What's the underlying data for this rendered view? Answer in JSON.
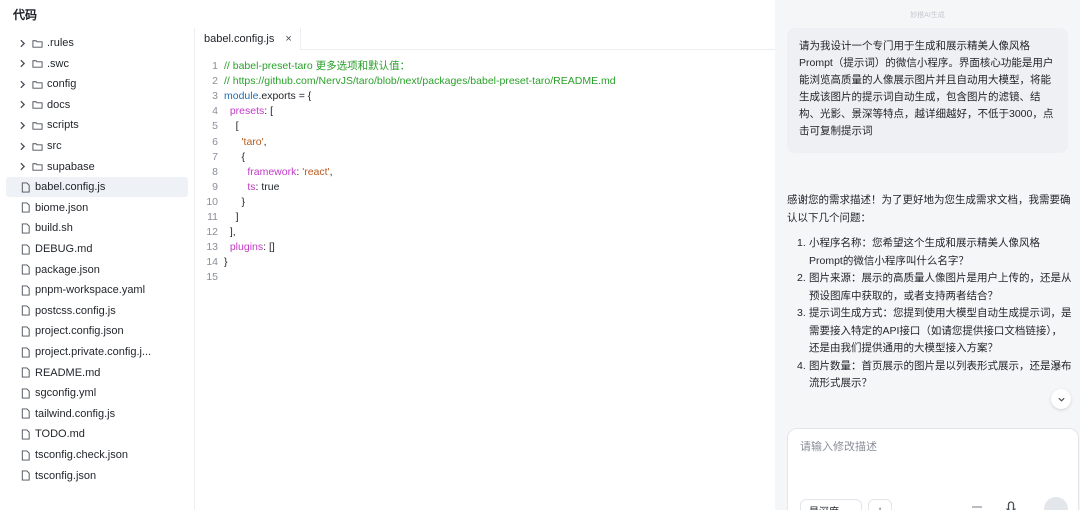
{
  "header": {
    "title": "代码"
  },
  "tree": {
    "items": [
      {
        "label": ".rules",
        "type": "folder"
      },
      {
        "label": ".swc",
        "type": "folder"
      },
      {
        "label": "config",
        "type": "folder"
      },
      {
        "label": "docs",
        "type": "folder"
      },
      {
        "label": "scripts",
        "type": "folder"
      },
      {
        "label": "src",
        "type": "folder"
      },
      {
        "label": "supabase",
        "type": "folder"
      },
      {
        "label": "babel.config.js",
        "type": "file",
        "selected": true
      },
      {
        "label": "biome.json",
        "type": "file"
      },
      {
        "label": "build.sh",
        "type": "file"
      },
      {
        "label": "DEBUG.md",
        "type": "file"
      },
      {
        "label": "package.json",
        "type": "file"
      },
      {
        "label": "pnpm-workspace.yaml",
        "type": "file"
      },
      {
        "label": "postcss.config.js",
        "type": "file"
      },
      {
        "label": "project.config.json",
        "type": "file"
      },
      {
        "label": "project.private.config.j...",
        "type": "file"
      },
      {
        "label": "README.md",
        "type": "file"
      },
      {
        "label": "sgconfig.yml",
        "type": "file"
      },
      {
        "label": "tailwind.config.js",
        "type": "file"
      },
      {
        "label": "TODO.md",
        "type": "file"
      },
      {
        "label": "tsconfig.check.json",
        "type": "file"
      },
      {
        "label": "tsconfig.json",
        "type": "file"
      }
    ]
  },
  "editor": {
    "tab": {
      "label": "babel.config.js",
      "close": "×"
    },
    "lines": [
      {
        "n": "1",
        "tokens": [
          [
            "c-comment",
            "// babel-preset-taro 更多选项和默认值："
          ]
        ]
      },
      {
        "n": "2",
        "tokens": [
          [
            "c-comment",
            "// https://github.com/NervJS/taro/blob/next/packages/babel-preset-taro/README.md"
          ]
        ]
      },
      {
        "n": "3",
        "tokens": [
          [
            "c-kw",
            "module"
          ],
          [
            "c-plain",
            ".exports = {"
          ]
        ]
      },
      {
        "n": "4",
        "tokens": [
          [
            "c-plain",
            "  "
          ],
          [
            "c-key",
            "presets"
          ],
          [
            "c-plain",
            ": ["
          ]
        ]
      },
      {
        "n": "5",
        "tokens": [
          [
            "c-plain",
            "    ["
          ]
        ]
      },
      {
        "n": "6",
        "tokens": [
          [
            "c-plain",
            "      "
          ],
          [
            "c-str",
            "'taro'"
          ],
          [
            "c-plain",
            ","
          ]
        ]
      },
      {
        "n": "7",
        "tokens": [
          [
            "c-plain",
            "      {"
          ]
        ]
      },
      {
        "n": "8",
        "tokens": [
          [
            "c-plain",
            "        "
          ],
          [
            "c-key",
            "framework"
          ],
          [
            "c-plain",
            ": "
          ],
          [
            "c-str",
            "'react'"
          ],
          [
            "c-plain",
            ","
          ]
        ]
      },
      {
        "n": "9",
        "tokens": [
          [
            "c-plain",
            "        "
          ],
          [
            "c-key",
            "ts"
          ],
          [
            "c-plain",
            ": true"
          ]
        ]
      },
      {
        "n": "10",
        "tokens": [
          [
            "c-plain",
            "      }"
          ]
        ]
      },
      {
        "n": "11",
        "tokens": [
          [
            "c-plain",
            "    ]"
          ]
        ]
      },
      {
        "n": "12",
        "tokens": [
          [
            "c-plain",
            "  ],"
          ]
        ]
      },
      {
        "n": "13",
        "tokens": [
          [
            "c-plain",
            "  "
          ],
          [
            "c-key",
            "plugins"
          ],
          [
            "c-plain",
            ": []"
          ]
        ]
      },
      {
        "n": "14",
        "tokens": [
          [
            "c-plain",
            "}"
          ]
        ]
      },
      {
        "n": "15",
        "tokens": []
      }
    ]
  },
  "assistant": {
    "label": "妙搭AI生成",
    "user_message": "请为我设计一个专门用于生成和展示精美人像风格Prompt（提示词）的微信小程序。界面核心功能是用户能浏览高质量的人像展示图片并且自动用大模型，将能生成该图片的提示词自动生成，包含图片的滤镜、结构、光影、景深等特点，越详细越好，不低于3000，点击可复制提示词",
    "reply_intro": "感谢您的需求描述！为了更好地为您生成需求文档，我需要确认以下几个问题：",
    "questions": [
      {
        "num": "1.",
        "text": "小程序名称：您希望这个生成和展示精美人像风格Prompt的微信小程序叫什么名字？"
      },
      {
        "num": "2.",
        "text": "图片来源：展示的高质量人像图片是用户上传的，还是从预设图库中获取的，或者支持两者结合？"
      },
      {
        "num": "3.",
        "text": "提示词生成方式：您提到使用大模型自动生成提示词，是需要接入特定的API接口（如请您提供接口文档链接），还是由我们提供通用的大模型接入方案？"
      },
      {
        "num": "4.",
        "text": "图片数量：首页展示的图片是以列表形式展示，还是瀑布流形式展示？"
      }
    ],
    "input_placeholder": "请输入修改描述",
    "mode_select": "是深度",
    "add_label": "+"
  },
  "colors": {
    "comment": "#2aa02a",
    "key": "#c23ac7",
    "string": "#b85a1e",
    "keyword": "#1f6fb5",
    "selected_bg": "#eef1f6",
    "panel_bg": "#f5f6f8"
  }
}
